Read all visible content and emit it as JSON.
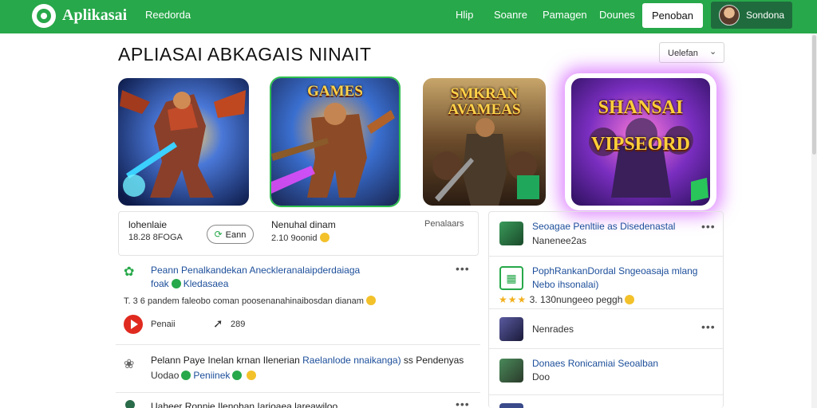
{
  "header": {
    "brand": "Aplikasai",
    "nav_left": "Reedorda",
    "nav": [
      "Hlip",
      "Soanre",
      "Pamagen",
      "Dounes"
    ],
    "cta_label": "Penoban",
    "user_name": "Sondona"
  },
  "page": {
    "title": "APLIASAI ABKAGAIS NINAIT",
    "sort_label": "Uelefan"
  },
  "tiles": [
    {
      "caption": ""
    },
    {
      "caption": "GAMES"
    },
    {
      "caption": "SMKRAN AVAMEAS"
    },
    {
      "caption": "SHANSAI VIPSEORD"
    }
  ],
  "stats": {
    "block1": {
      "title": "lohenlaie",
      "sub": "18.28 8FOGA"
    },
    "pill": {
      "label": "Eann",
      "icon": "reply-arrow-icon"
    },
    "block2": {
      "title": "Nenuhal dinam",
      "sub": "2.10 9oonid"
    },
    "block3": {
      "title": "Penalaars"
    }
  },
  "feed": [
    {
      "title": "Peann Penalkandekan Aneckleranalaipderdaiaga",
      "sub_left": "foak",
      "sub_right": "Kledasaea",
      "meta": "T. 3 6 pandem faleobo coman poosenanahinaibosdan dianam",
      "action_label": "Penaii",
      "share_count": "289"
    },
    {
      "title": "Pelann Paye Inelan krnan Ilenerian",
      "title_link": "Raelanlode nnaikanga)",
      "title_tail": "ss Pendenyas",
      "sub_left": "Uodao",
      "sub_right": "Peniinek"
    },
    {
      "title": "Uaheer Ronnie Ilenohan Iarioaea lareawiloo"
    }
  ],
  "side": [
    {
      "title": "Seoagae Penltiie as Disedenastal",
      "sub": "Nanenee2as"
    },
    {
      "title": "PophRankanDordal Sngeoasaja mlang",
      "sub": "Nebo ihsonalai)",
      "meta": "3. 130nungeeo peggh"
    },
    {
      "title": "",
      "sub": "Nenrades"
    },
    {
      "title": "Donaes Ronicamiai Seoalban",
      "sub": "Doo"
    }
  ],
  "colors": {
    "brand_green": "#27a84a",
    "link_blue": "#1c4e9a",
    "play_red": "#e02a1f"
  }
}
